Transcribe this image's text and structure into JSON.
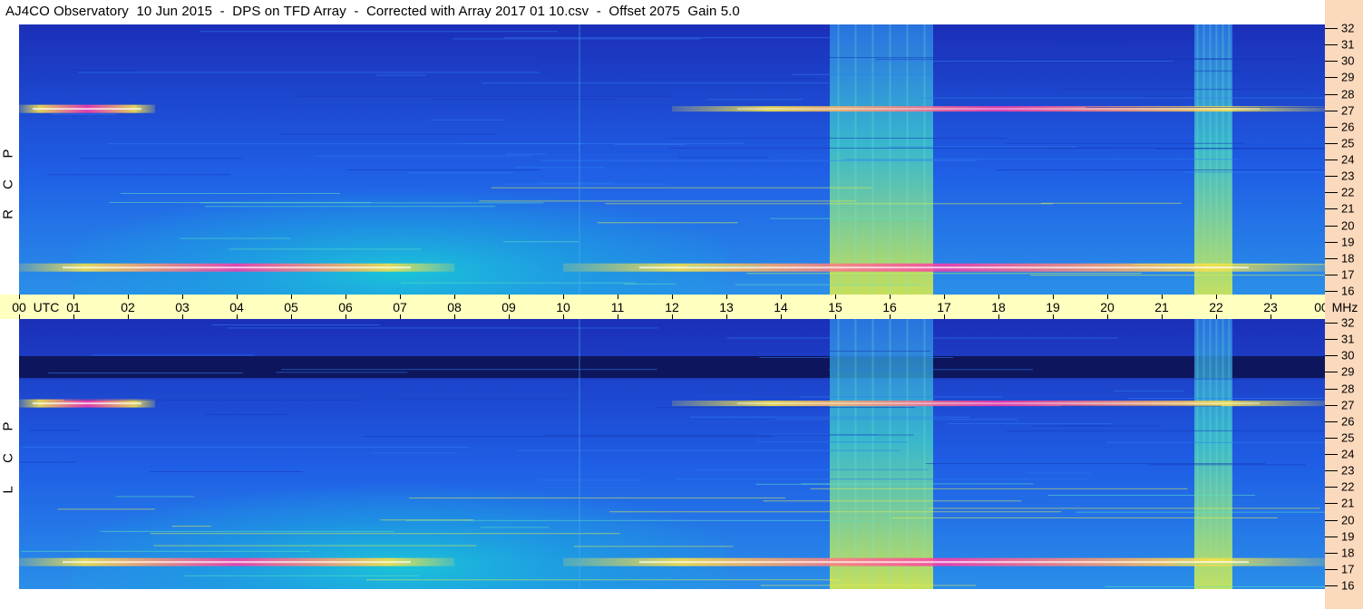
{
  "title": "AJ4CO Observatory  10 Jun 2015  -  DPS on TFD Array  -  Corrected with Array 2017 01 10.csv  -  Offset 2075  Gain 5.0",
  "chart_data": [
    {
      "type": "heatmap",
      "name": "RCP",
      "polarization_letters": [
        "R",
        "C",
        "P"
      ],
      "x_axis": {
        "unit": "UTC",
        "range": [
          0,
          24
        ],
        "tick_labels": [
          "00",
          "01",
          "02",
          "03",
          "04",
          "05",
          "06",
          "07",
          "08",
          "09",
          "10",
          "11",
          "12",
          "13",
          "14",
          "15",
          "16",
          "17",
          "18",
          "19",
          "20",
          "21",
          "22",
          "23",
          "00"
        ]
      },
      "y_axis": {
        "unit": "MHz",
        "range": [
          16,
          32
        ],
        "tick_labels": [
          "16",
          "17",
          "18",
          "19",
          "20",
          "21",
          "22",
          "23",
          "24",
          "25",
          "26",
          "27",
          "28",
          "29",
          "30",
          "31",
          "32"
        ]
      },
      "features": [
        {
          "kind": "emission band",
          "freq_mhz": 27.0,
          "utc_range": [
            0,
            2.5
          ],
          "intensity": "high"
        },
        {
          "kind": "emission band",
          "freq_mhz": 27.0,
          "utc_range": [
            12,
            24
          ],
          "intensity": "medium"
        },
        {
          "kind": "emission band",
          "freq_mhz": 17.6,
          "utc_range": [
            0,
            8
          ],
          "intensity": "high"
        },
        {
          "kind": "emission band",
          "freq_mhz": 17.6,
          "utc_range": [
            10,
            24
          ],
          "intensity": "high"
        },
        {
          "kind": "broadband noise",
          "utc_range": [
            14.9,
            16.8
          ],
          "freq_range": [
            16,
            32
          ]
        },
        {
          "kind": "broadband noise",
          "utc_range": [
            21.6,
            22.3
          ],
          "freq_range": [
            16,
            32
          ]
        },
        {
          "kind": "daytime background",
          "utc_range": [
            3,
            12
          ],
          "freq_range": [
            16,
            25
          ]
        }
      ]
    },
    {
      "type": "heatmap",
      "name": "LCP",
      "polarization_letters": [
        "L",
        "C",
        "P"
      ],
      "x_axis": {
        "unit": "UTC",
        "range": [
          0,
          24
        ],
        "tick_labels": [
          "00",
          "01",
          "02",
          "03",
          "04",
          "05",
          "06",
          "07",
          "08",
          "09",
          "10",
          "11",
          "12",
          "13",
          "14",
          "15",
          "16",
          "17",
          "18",
          "19",
          "20",
          "21",
          "22",
          "23",
          "00"
        ]
      },
      "y_axis": {
        "unit": "MHz",
        "range": [
          16,
          32
        ],
        "tick_labels": [
          "16",
          "17",
          "18",
          "19",
          "20",
          "21",
          "22",
          "23",
          "24",
          "25",
          "26",
          "27",
          "28",
          "29",
          "30",
          "31",
          "32"
        ]
      },
      "features": [
        {
          "kind": "emission band",
          "freq_mhz": 27.0,
          "utc_range": [
            0,
            2.5
          ],
          "intensity": "high"
        },
        {
          "kind": "emission band",
          "freq_mhz": 27.0,
          "utc_range": [
            12,
            24
          ],
          "intensity": "medium"
        },
        {
          "kind": "emission band",
          "freq_mhz": 17.6,
          "utc_range": [
            0,
            8
          ],
          "intensity": "high"
        },
        {
          "kind": "emission band",
          "freq_mhz": 17.6,
          "utc_range": [
            10,
            24
          ],
          "intensity": "high"
        },
        {
          "kind": "dark band",
          "freq_range": [
            28.5,
            29.8
          ],
          "utc_range": [
            0,
            24
          ]
        },
        {
          "kind": "broadband noise",
          "utc_range": [
            14.9,
            16.8
          ],
          "freq_range": [
            16,
            32
          ]
        },
        {
          "kind": "broadband noise",
          "utc_range": [
            21.6,
            22.3
          ],
          "freq_range": [
            16,
            32
          ]
        },
        {
          "kind": "daytime background",
          "utc_range": [
            3,
            12
          ],
          "freq_range": [
            16,
            25
          ]
        }
      ]
    }
  ],
  "time_axis": {
    "labels": [
      "00",
      "01",
      "02",
      "03",
      "04",
      "05",
      "06",
      "07",
      "08",
      "09",
      "10",
      "11",
      "12",
      "13",
      "14",
      "15",
      "16",
      "17",
      "18",
      "19",
      "20",
      "21",
      "22",
      "23",
      "00"
    ],
    "utc_label": "UTC",
    "mhz_label": "MHz"
  },
  "freq_axis": {
    "labels": [
      "32",
      "31",
      "30",
      "29",
      "28",
      "27",
      "26",
      "25",
      "24",
      "23",
      "22",
      "21",
      "20",
      "19",
      "18",
      "17",
      "16"
    ]
  },
  "colors": {
    "background_dark": "#1b2fb8",
    "background_mid": "#1f5fe6",
    "daytime": "#19c8d8",
    "emission_warm": "#f4e04a",
    "emission_hot": "#ff3aa8",
    "axis_band": "#ffffc0",
    "right_strip": "#fbd9bd"
  }
}
